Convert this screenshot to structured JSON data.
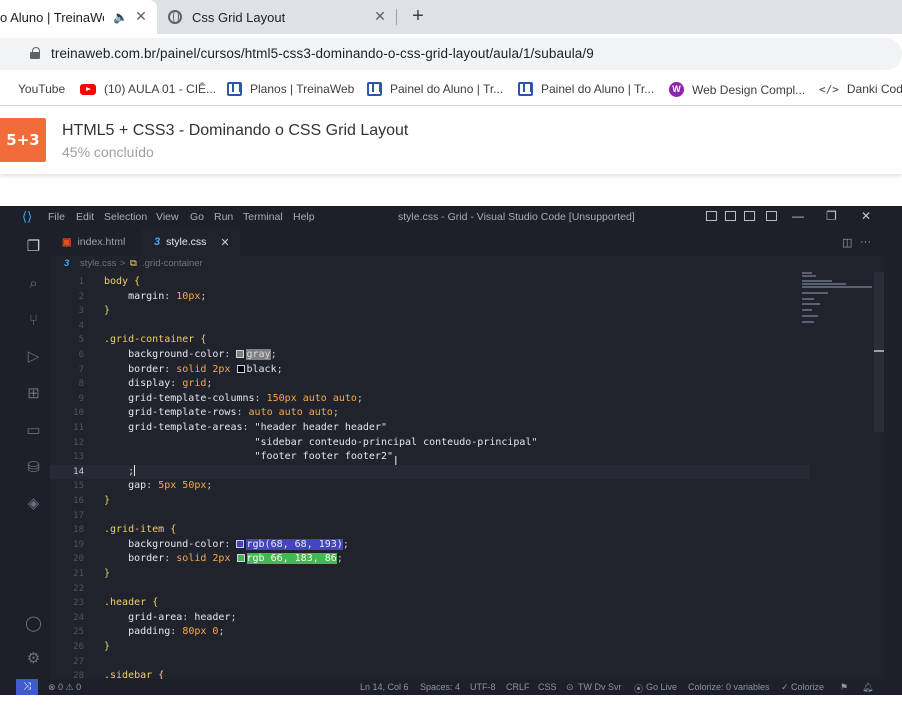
{
  "browser": {
    "tabs": [
      {
        "title": "o Aluno | TreinaWeb",
        "active": true
      },
      {
        "title": "Css Grid Layout",
        "active": false
      }
    ],
    "new_tab": "+",
    "close_glyph": "✕",
    "url": "treinaweb.com.br/painel/cursos/html5-css3-dominando-o-css-grid-layout/aula/1/subaula/9",
    "bookmarks": [
      {
        "label": "YouTube",
        "icon": "youtube-icon"
      },
      {
        "label": "(10) AULA 01 - CIÊ...",
        "icon": "youtube-icon"
      },
      {
        "label": "Planos | TreinaWeb",
        "icon": "treinaweb-icon"
      },
      {
        "label": "Painel do Aluno | Tr...",
        "icon": "treinaweb-icon"
      },
      {
        "label": "Painel do Aluno | Tr...",
        "icon": "treinaweb-icon"
      },
      {
        "label": "Web Design Compl...",
        "icon": "webdesign-icon"
      },
      {
        "label": "Danki Code",
        "icon": "code-icon"
      }
    ]
  },
  "course": {
    "title": "HTML5 + CSS3 - Dominando o CSS Grid Layout",
    "progress_text": "45% concluído",
    "progress": 45,
    "logo_text": "5+3",
    "accent": "#f26b3a"
  },
  "vscode": {
    "menu": [
      "File",
      "Edit",
      "Selection",
      "View",
      "Go",
      "Run",
      "Terminal",
      "Help"
    ],
    "window_title": "style.css - Grid - Visual Studio Code [Unsupported]",
    "tabs": [
      {
        "name": "index.html",
        "active": false
      },
      {
        "name": "style.css",
        "active": true
      }
    ],
    "breadcrumb": [
      "style.css",
      ">",
      ".grid-container"
    ],
    "current_line": 14,
    "status": {
      "errors": "⊗ 0 ⚠ 0",
      "position": "Ln 14, Col 6",
      "spaces": "Spaces: 4",
      "encoding": "UTF-8",
      "eol": "CRLF",
      "language": "CSS",
      "tw": "TW Dv Svr",
      "golive": "Go Live",
      "colorize_vars": "Colorize: 0 variables",
      "colorize": "✓ Colorize"
    },
    "code": [
      {
        "n": "1",
        "t": "body {"
      },
      {
        "n": "2",
        "t": "    margin: 10px;"
      },
      {
        "n": "3",
        "t": "}"
      },
      {
        "n": "4",
        "t": ""
      },
      {
        "n": "5",
        "t": ".grid-container {"
      },
      {
        "n": "6",
        "t": "    background-color: gray;"
      },
      {
        "n": "7",
        "t": "    border: solid 2px black;"
      },
      {
        "n": "8",
        "t": "    display: grid;"
      },
      {
        "n": "9",
        "t": "    grid-template-columns: 150px auto auto;"
      },
      {
        "n": "10",
        "t": "    grid-template-rows: auto auto auto;"
      },
      {
        "n": "11",
        "t": "    grid-template-areas: \"header header header\""
      },
      {
        "n": "12",
        "t": "                         \"sidebar conteudo-principal conteudo-principal\""
      },
      {
        "n": "13",
        "t": "                         \"footer footer footer2\""
      },
      {
        "n": "14",
        "t": "    ;"
      },
      {
        "n": "15",
        "t": "    gap: 5px 50px;"
      },
      {
        "n": "16",
        "t": "}"
      },
      {
        "n": "17",
        "t": ""
      },
      {
        "n": "18",
        "t": ".grid-item {"
      },
      {
        "n": "19",
        "t": "    background-color: rgb(68, 68, 193);"
      },
      {
        "n": "20",
        "t": "    border: solid 2px rgb 66, 183, 86;"
      },
      {
        "n": "21",
        "t": "}"
      },
      {
        "n": "22",
        "t": ""
      },
      {
        "n": "23",
        "t": ".header {"
      },
      {
        "n": "24",
        "t": "    grid-area: header;"
      },
      {
        "n": "25",
        "t": "    padding: 80px 0;"
      },
      {
        "n": "26",
        "t": "}"
      },
      {
        "n": "27",
        "t": ""
      },
      {
        "n": "28",
        "t": ".sidebar {"
      }
    ],
    "colors": {
      "blue_swatch": "#4444c1",
      "green_swatch": "#42b756",
      "gray_swatch": "#808080"
    }
  }
}
